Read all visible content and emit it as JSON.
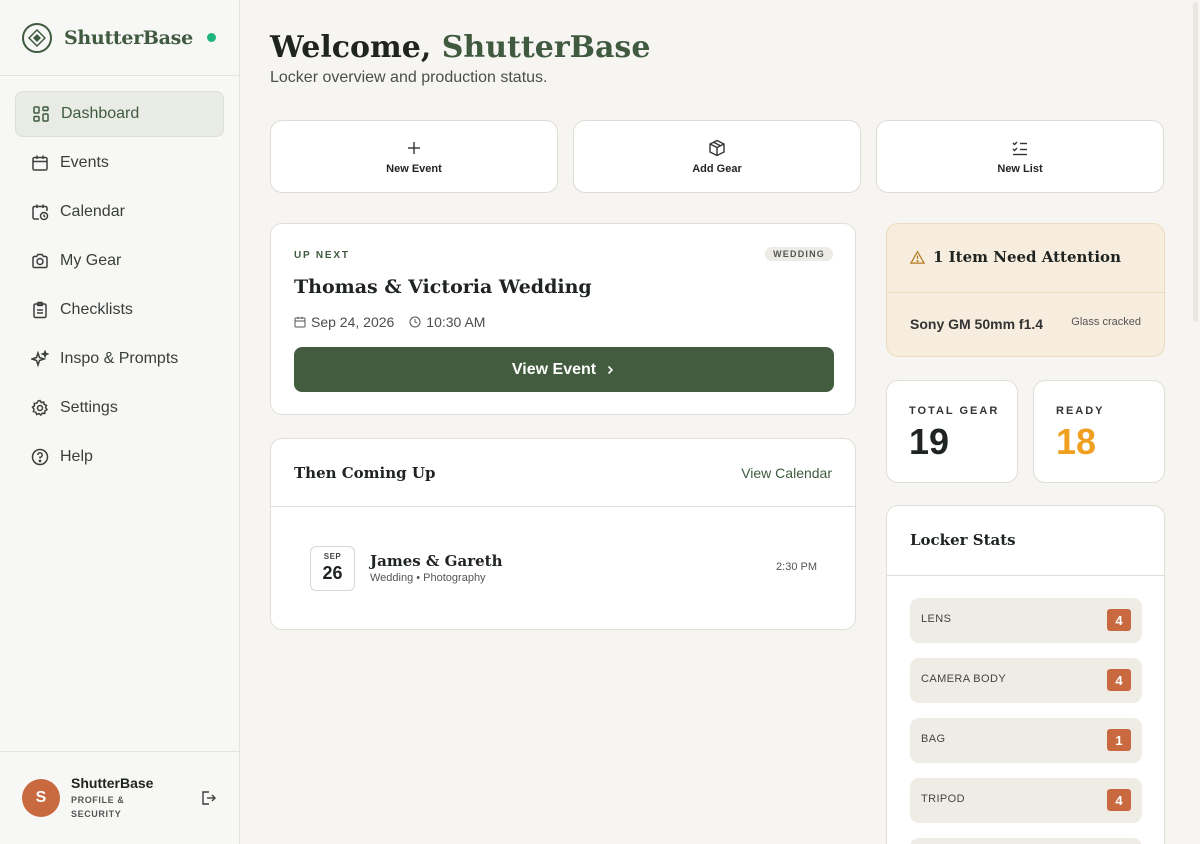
{
  "sidebar": {
    "brand": "ShutterBase",
    "nav": [
      {
        "label": "Dashboard",
        "icon": "dashboard-icon",
        "active": true
      },
      {
        "label": "Events",
        "icon": "calendar-icon"
      },
      {
        "label": "Calendar",
        "icon": "calendar-clock-icon"
      },
      {
        "label": "My Gear",
        "icon": "camera-icon"
      },
      {
        "label": "Checklists",
        "icon": "clipboard-icon"
      },
      {
        "label": "Inspo & Prompts",
        "icon": "sparkles-icon"
      },
      {
        "label": "Settings",
        "icon": "gear-icon"
      },
      {
        "label": "Help",
        "icon": "help-icon"
      }
    ],
    "profile": {
      "initial": "S",
      "name": "ShutterBase",
      "sub": "PROFILE & SECURITY"
    }
  },
  "header": {
    "welcome": "Welcome,",
    "brand": "ShutterBase",
    "subtitle": "Locker overview and production status."
  },
  "quick_actions": [
    {
      "label": "New Event",
      "icon": "plus-icon"
    },
    {
      "label": "Add Gear",
      "icon": "package-icon"
    },
    {
      "label": "New List",
      "icon": "checklist-icon"
    }
  ],
  "up_next": {
    "label": "UP NEXT",
    "badge": "WEDDING",
    "title": "Thomas & Victoria Wedding",
    "date": "Sep 24, 2026",
    "time": "10:30 AM",
    "button": "View Event"
  },
  "then_coming": {
    "title": "Then Coming Up",
    "link": "View Calendar",
    "event": {
      "month": "SEP",
      "day": "26",
      "title": "James & Gareth",
      "sub": "Wedding • Photography",
      "time": "2:30 PM"
    }
  },
  "attention": {
    "title": "1 Item Need Attention",
    "item": "Sony GM 50mm f1.4",
    "note": "Glass cracked"
  },
  "stats": {
    "total": {
      "label": "TOTAL GEAR",
      "value": "19"
    },
    "ready": {
      "label": "READY",
      "value": "18"
    }
  },
  "locker": {
    "title": "Locker Stats",
    "rows": [
      {
        "name": "LENS",
        "count": "4"
      },
      {
        "name": "CAMERA BODY",
        "count": "4"
      },
      {
        "name": "BAG",
        "count": "1"
      },
      {
        "name": "TRIPOD",
        "count": "4"
      }
    ]
  },
  "colors": {
    "accent": "#3f5a3f",
    "orange": "#c8693f",
    "ready": "#f0a020",
    "status": "#1fb57a"
  }
}
